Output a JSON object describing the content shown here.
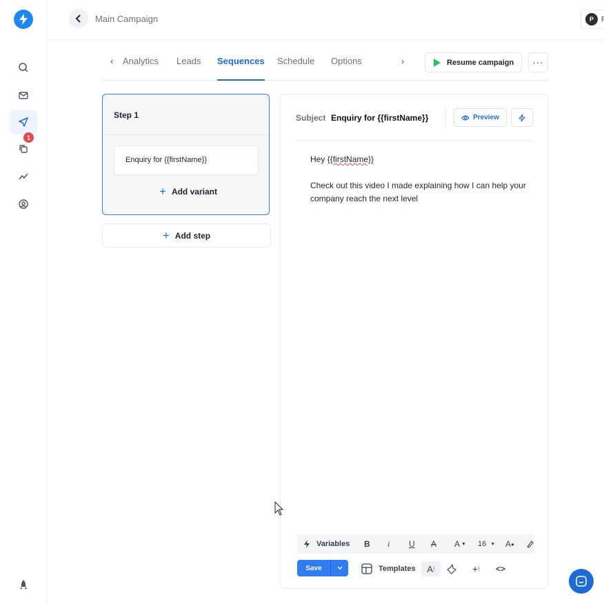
{
  "colors": {
    "accent": "#1e6bd6",
    "play": "#22c55e",
    "badge": "#e5484d",
    "save": "#2f7cf0"
  },
  "sidebar": {
    "logo_icon": "lightning-icon",
    "items": [
      {
        "icon": "search-icon"
      },
      {
        "icon": "mail-icon"
      },
      {
        "icon": "send-icon",
        "active": true
      },
      {
        "icon": "copy-icon",
        "badge": "1"
      },
      {
        "icon": "trend-icon"
      },
      {
        "icon": "user-circle-icon"
      }
    ],
    "bottom_icon": "rocket-icon"
  },
  "header": {
    "title": "Main Campaign",
    "avatar_initial": "P",
    "avatar_tail": "F"
  },
  "tabs": {
    "items": [
      "Analytics",
      "Leads",
      "Sequences",
      "Schedule",
      "Options"
    ],
    "active": "Sequences"
  },
  "actions": {
    "resume_label": "Resume campaign",
    "more_label": "···"
  },
  "steps": {
    "title": "Step 1",
    "variant": "Enquiry for {{firstName}}",
    "add_variant": "Add variant",
    "add_step": "Add step"
  },
  "editor": {
    "subject_label": "Subject",
    "subject_value": "Enquiry for {{firstName}}",
    "preview_label": "Preview",
    "greeting_prefix": "Hey ",
    "greeting_var": "{{firstName}}",
    "body": "Check out this video I made explaining how I can help your company reach the next level"
  },
  "toolbar": {
    "variables_label": "Variables",
    "font_size": "16",
    "save_label": "Save",
    "templates_label": "Templates"
  }
}
